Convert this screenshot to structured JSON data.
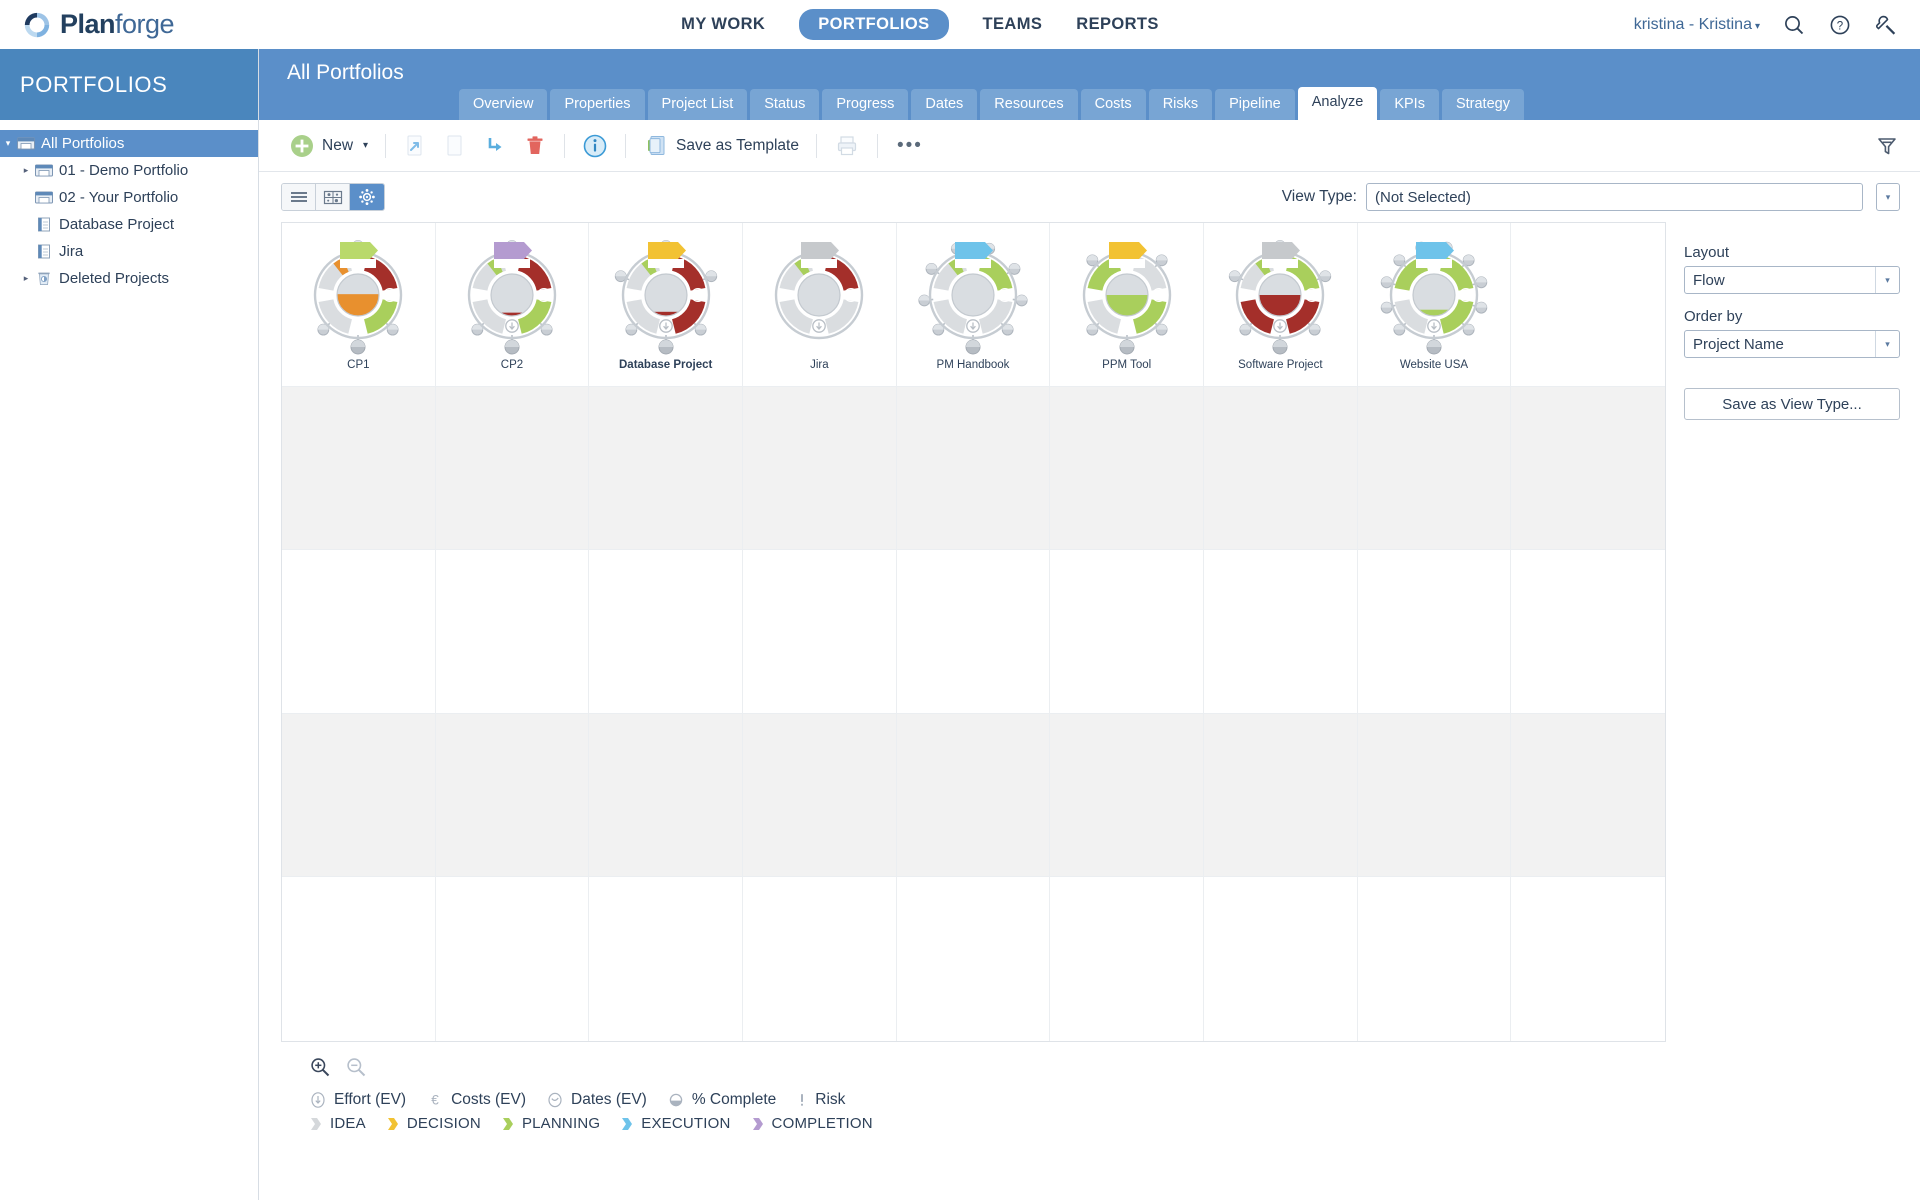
{
  "header": {
    "logo_text_bold": "Plan",
    "logo_text_light": "forge",
    "logo_icon": "circular-arrow-icon",
    "nav": [
      {
        "label": "MY WORK",
        "active": false
      },
      {
        "label": "PORTFOLIOS",
        "active": true
      },
      {
        "label": "TEAMS",
        "active": false
      },
      {
        "label": "REPORTS",
        "active": false
      }
    ],
    "user_label": "kristina - Kristina",
    "user_caret": "▾",
    "icons": [
      "search-icon",
      "help-icon",
      "settings-wrench-icon"
    ]
  },
  "sidebar": {
    "title": "PORTFOLIOS",
    "items": [
      {
        "label": "All Portfolios",
        "icon": "portfolio-folder-icon",
        "twisty": "▾",
        "indent": 0,
        "selected": true
      },
      {
        "label": "01 - Demo Portfolio",
        "icon": "portfolio-folder-icon",
        "twisty": "▸",
        "indent": 1,
        "selected": false
      },
      {
        "label": "02 - Your Portfolio",
        "icon": "portfolio-folder-icon",
        "twisty": "",
        "indent": 1,
        "selected": false
      },
      {
        "label": "Database Project",
        "icon": "project-doc-icon",
        "twisty": "",
        "indent": 1,
        "selected": false
      },
      {
        "label": "Jira",
        "icon": "project-doc-icon",
        "twisty": "",
        "indent": 1,
        "selected": false
      },
      {
        "label": "Deleted Projects",
        "icon": "trash-icon",
        "twisty": "▸",
        "indent": 1,
        "selected": false
      }
    ]
  },
  "main": {
    "page_title": "All Portfolios",
    "tabs": [
      {
        "label": "Overview",
        "active": false
      },
      {
        "label": "Properties",
        "active": false
      },
      {
        "label": "Project List",
        "active": false
      },
      {
        "label": "Status",
        "active": false
      },
      {
        "label": "Progress",
        "active": false
      },
      {
        "label": "Dates",
        "active": false
      },
      {
        "label": "Resources",
        "active": false
      },
      {
        "label": "Costs",
        "active": false
      },
      {
        "label": "Risks",
        "active": false
      },
      {
        "label": "Pipeline",
        "active": false
      },
      {
        "label": "Analyze",
        "active": true
      },
      {
        "label": "KPIs",
        "active": false
      },
      {
        "label": "Strategy",
        "active": false
      }
    ]
  },
  "toolbar": {
    "new_label": "New",
    "new_caret": "▾",
    "save_template_label": "Save as Template",
    "overflow_label": "•••",
    "icons": [
      "new-plus-icon",
      "cut-icon",
      "copy-icon",
      "move-icon",
      "delete-icon",
      "info-icon",
      "save-template-icon",
      "print-icon",
      "more-icon",
      "filter-icon"
    ]
  },
  "viewbar": {
    "modes": [
      {
        "name": "list-view",
        "active": false
      },
      {
        "name": "bubble-view",
        "active": false
      },
      {
        "name": "flow-view",
        "active": true
      }
    ],
    "view_type_label": "View Type:",
    "view_type_value": "(Not Selected)",
    "dropdown_caret": "▾"
  },
  "right_panel": {
    "layout_label": "Layout",
    "layout_value": "Flow",
    "order_label": "Order by",
    "order_value": "Project Name",
    "save_view_label": "Save as View Type..."
  },
  "chart_data": {
    "type": "flow-node-grid",
    "columns": 9,
    "rows": 5,
    "banded_rows": [
      2,
      4
    ],
    "nodes": [
      {
        "label": "CP1",
        "col": 1,
        "bold": false,
        "flag": "#b9d96b",
        "segments": {
          "costs": "#dadde0",
          "dates": "#a42f2a",
          "effort": "#a9cf5c",
          "quality": "#dadde0"
        },
        "accent_wedge": "#e8902e",
        "center_fill": "#e8902e",
        "center_level": 0.52,
        "satellites": 3,
        "icon_highlight": "effort"
      },
      {
        "label": "CP2",
        "col": 2,
        "bold": false,
        "flag": "#b49bd0",
        "segments": {
          "costs": "#dadde0",
          "dates": "#a42f2a",
          "effort": "#a9cf5c",
          "quality": "#dadde0"
        },
        "accent_wedge": "#a9cf5c",
        "center_fill": "#a42f2a",
        "center_level": 0.08,
        "satellites": 3,
        "icon_highlight": "none"
      },
      {
        "label": "Database Project",
        "col": 3,
        "bold": true,
        "flag": "#f2c233",
        "segments": {
          "costs": "#dadde0",
          "dates": "#a42f2a",
          "effort": "#a42f2a",
          "quality": "#dadde0"
        },
        "accent_wedge": "#a9cf5c",
        "center_fill": "#a42f2a",
        "center_level": 0.1,
        "satellites": 5,
        "icon_highlight": "none"
      },
      {
        "label": "Jira",
        "col": 4,
        "bold": false,
        "flag": "#c6c9cc",
        "segments": {
          "costs": "#dadde0",
          "dates": "#a42f2a",
          "effort": "#dadde0",
          "quality": "#dadde0"
        },
        "accent_wedge": "#a9cf5c",
        "center_fill": "#dadde0",
        "center_level": 0.0,
        "satellites": 0,
        "icon_highlight": "none"
      },
      {
        "label": "PM Handbook",
        "col": 5,
        "bold": false,
        "flag": "#6ec3ea",
        "segments": {
          "costs": "#dadde0",
          "dates": "#a9cf5c",
          "effort": "#dadde0",
          "quality": "#dadde0"
        },
        "accent_wedge": "#a9cf5c",
        "center_fill": "#dadde0",
        "center_level": 0.0,
        "satellites": 8,
        "icon_highlight": "none"
      },
      {
        "label": "PPM Tool",
        "col": 6,
        "bold": false,
        "flag": "#f2c233",
        "segments": {
          "costs": "#dadde0",
          "dates": "#dadde0",
          "effort": "#a9cf5c",
          "quality": "#a9cf5c"
        },
        "accent_wedge": "#a9cf5c",
        "center_fill": "#a9cf5c",
        "center_level": 0.5,
        "satellites": 4,
        "icon_highlight": "effort"
      },
      {
        "label": "Software Project",
        "col": 7,
        "bold": false,
        "flag": "#c6c9cc",
        "segments": {
          "costs": "#a42f2a",
          "dates": "#a9cf5c",
          "effort": "#a42f2a",
          "quality": "#dadde0"
        },
        "accent_wedge": "#a9cf5c",
        "center_fill": "#a42f2a",
        "center_level": 0.5,
        "satellites": 5,
        "icon_highlight": "none"
      },
      {
        "label": "Website USA",
        "col": 8,
        "bold": false,
        "flag": "#6ec3ea",
        "segments": {
          "costs": "#dadde0",
          "dates": "#a9cf5c",
          "effort": "#a9cf5c",
          "quality": "#a9cf5c"
        },
        "accent_wedge": "#a9cf5c",
        "center_fill": "#a9cf5c",
        "center_level": 0.15,
        "satellites": 10,
        "icon_highlight": "none"
      }
    ]
  },
  "footer": {
    "zoom_in": "zoom-in-icon",
    "zoom_out": "zoom-out-icon",
    "metrics": [
      {
        "label": "Effort (EV)",
        "icon": "effort-icon"
      },
      {
        "label": "Costs (EV)",
        "icon": "euro-icon"
      },
      {
        "label": "Dates (EV)",
        "icon": "clock-icon"
      },
      {
        "label": "% Complete",
        "icon": "percent-icon"
      },
      {
        "label": "Risk",
        "icon": "risk-icon"
      }
    ],
    "phases": [
      {
        "label": "IDEA",
        "color": "#d5d8db"
      },
      {
        "label": "DECISION",
        "color": "#f2c233"
      },
      {
        "label": "PLANNING",
        "color": "#a9cf5c"
      },
      {
        "label": "EXECUTION",
        "color": "#6ec3ea"
      },
      {
        "label": "COMPLETION",
        "color": "#b49bd0"
      }
    ]
  }
}
